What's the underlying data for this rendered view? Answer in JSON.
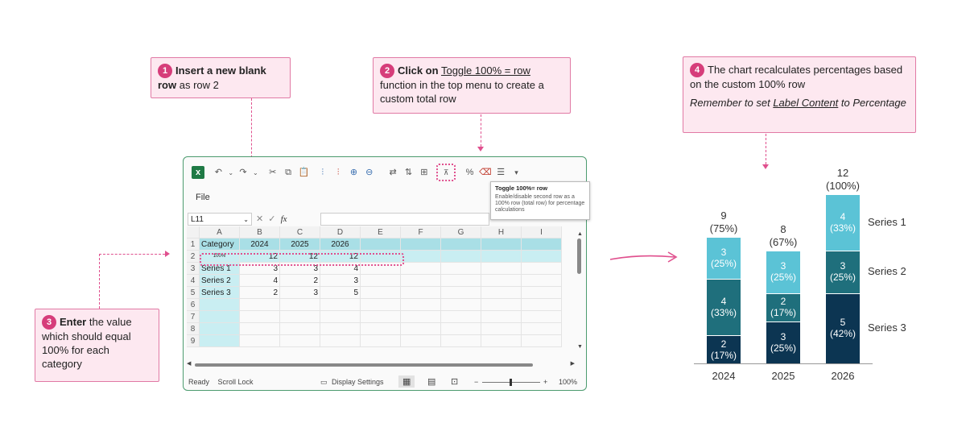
{
  "callouts": {
    "step1": {
      "num": "1",
      "bold": "Insert a new blank row",
      "rest": " as row 2"
    },
    "step2": {
      "num": "2",
      "bold": "Click on",
      "link": "Toggle 100% = row",
      "rest": " function in the top menu to create a custom total row"
    },
    "step3": {
      "num": "3",
      "bold": "Enter",
      "rest": " the value which should equal 100% for each category"
    },
    "step4": {
      "num": "4",
      "line1": "The chart recalculates percentages based on the custom 100% row",
      "italic_pre": "Remember to set ",
      "italic_link": "Label Content",
      "italic_post": " to Percentage"
    }
  },
  "excel": {
    "menu_file": "File",
    "name_box": "L11",
    "fx": "fx",
    "tooltip_title": "Toggle 100%= row",
    "tooltip_body": "Enable/disable second row as a 100% row (total row) for percentage calculations",
    "toolbar_percent": "%",
    "columns": [
      "",
      "A",
      "B",
      "C",
      "D",
      "E",
      "F",
      "G",
      "H",
      "I"
    ],
    "rows": [
      [
        "1",
        "Category",
        "2024",
        "2025",
        "2026"
      ],
      [
        "2",
        "100%",
        "12",
        "12",
        "12"
      ],
      [
        "3",
        "Series 1",
        "3",
        "3",
        "4"
      ],
      [
        "4",
        "Series 2",
        "4",
        "2",
        "3"
      ],
      [
        "5",
        "Series 3",
        "2",
        "3",
        "5"
      ],
      [
        "6",
        "",
        "",
        "",
        ""
      ],
      [
        "7",
        "",
        "",
        "",
        ""
      ],
      [
        "8",
        "",
        "",
        "",
        ""
      ],
      [
        "9",
        "",
        "",
        "",
        ""
      ]
    ],
    "status_ready": "Ready",
    "status_scroll": "Scroll Lock",
    "status_display": "Display Settings",
    "zoom": "100%",
    "zoom_minus": "−",
    "zoom_plus": "+"
  },
  "chart_data": {
    "type": "bar",
    "stacked": true,
    "categories": [
      "2024",
      "2025",
      "2026"
    ],
    "series": [
      {
        "name": "Series 1",
        "values": [
          3,
          3,
          4
        ],
        "labels": [
          "3\n(25%)",
          "3\n(25%)",
          "4\n(33%)"
        ],
        "color": "#5bc3d6"
      },
      {
        "name": "Series 2",
        "values": [
          4,
          2,
          3
        ],
        "labels": [
          "4\n(33%)",
          "2\n(17%)",
          "3\n(25%)"
        ],
        "color": "#1f6f7c"
      },
      {
        "name": "Series 3",
        "values": [
          2,
          3,
          5
        ],
        "labels": [
          "2\n(17%)",
          "3\n(25%)",
          "5\n(42%)"
        ],
        "color": "#0c3552"
      }
    ],
    "totals": [
      "9\n(75%)",
      "8\n(67%)",
      "12\n(100%)"
    ],
    "legend_placement": "right"
  },
  "colors": {
    "accent": "#d63d7a",
    "callout_bg": "#fde8f0",
    "excel_border": "#4c9b6f",
    "highlight_row": "#a9dfe6"
  }
}
